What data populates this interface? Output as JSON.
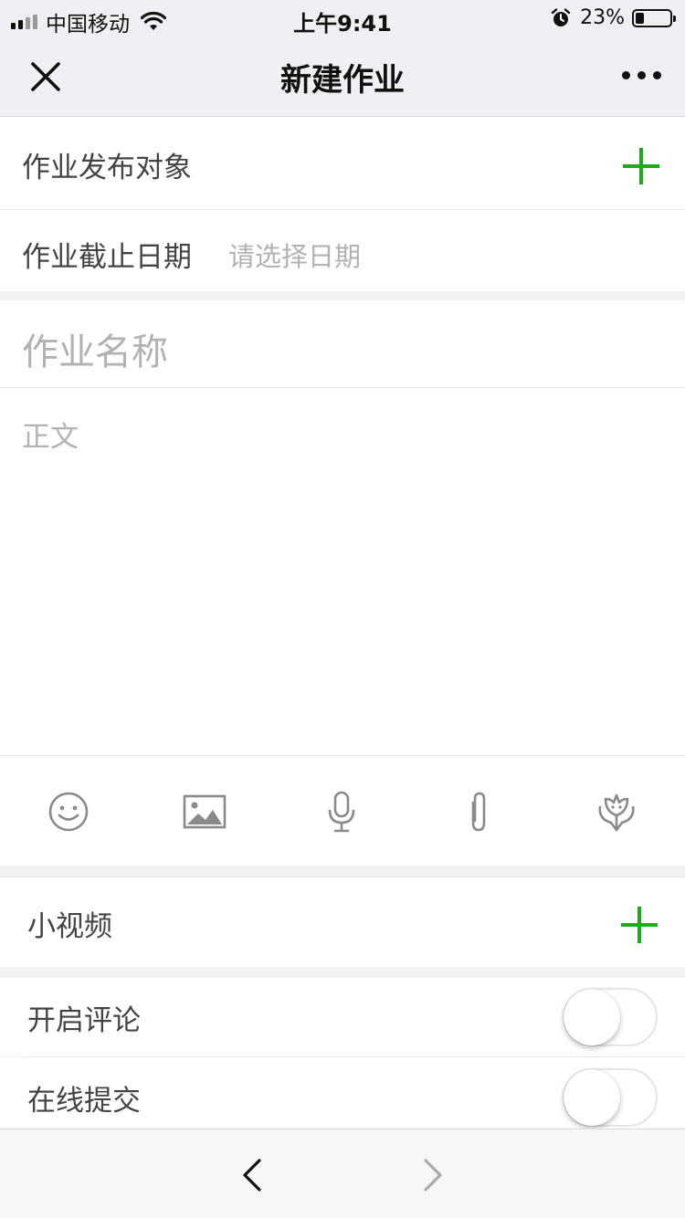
{
  "status_bar": {
    "carrier": "中国移动",
    "time": "上午9:41",
    "battery_percent": "23%",
    "battery_level": 0.23,
    "icons": [
      "signal-icon",
      "wifi-icon",
      "alarm-icon",
      "battery-icon"
    ]
  },
  "nav": {
    "title": "新建作业",
    "close_icon": "close-icon",
    "more_icon": "more-icon"
  },
  "form": {
    "target_label": "作业发布对象",
    "deadline_label": "作业截止日期",
    "deadline_placeholder": "请选择日期",
    "name_placeholder": "作业名称",
    "body_placeholder": "正文"
  },
  "toolbar": {
    "icons": [
      "emoji-icon",
      "image-icon",
      "microphone-icon",
      "attachment-icon",
      "flower-icon"
    ]
  },
  "video": {
    "label": "小视频"
  },
  "settings": {
    "comments_label": "开启评论",
    "comments_enabled": false,
    "online_submit_label": "在线提交",
    "online_submit_enabled": false
  },
  "colors": {
    "accent": "#1aad19",
    "placeholder": "#b2b2b2",
    "background": "#f2f2f2"
  }
}
